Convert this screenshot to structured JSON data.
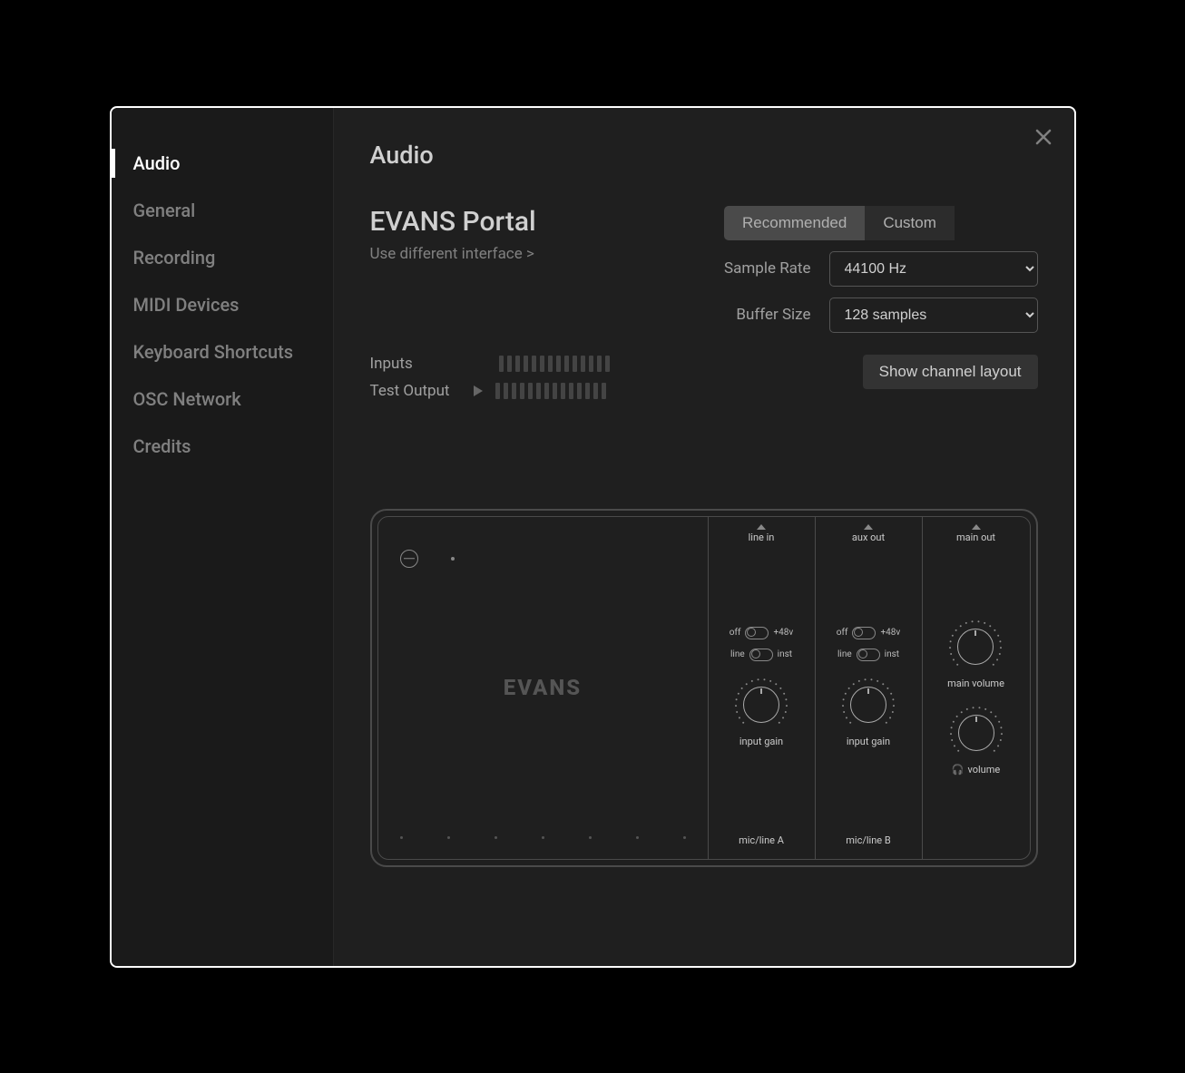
{
  "page_title": "Audio",
  "sidebar": {
    "items": [
      {
        "label": "Audio",
        "active": true
      },
      {
        "label": "General"
      },
      {
        "label": "Recording"
      },
      {
        "label": "MIDI Devices"
      },
      {
        "label": "Keyboard Shortcuts"
      },
      {
        "label": "OSC Network"
      },
      {
        "label": "Credits"
      }
    ]
  },
  "device": {
    "name": "EVANS Portal",
    "change_link": "Use different interface >"
  },
  "preset": {
    "recommended": "Recommended",
    "custom": "Custom"
  },
  "settings": {
    "sample_rate_label": "Sample Rate",
    "sample_rate_value": "44100 Hz",
    "buffer_label": "Buffer Size",
    "buffer_value": "128 samples"
  },
  "meters": {
    "inputs_label": "Inputs",
    "test_output_label": "Test Output",
    "channel_layout_btn": "Show channel layout"
  },
  "panel": {
    "brand": "EVANS",
    "sections": {
      "line_in": "line in",
      "aux_out": "aux out",
      "main_out": "main out"
    },
    "toggles": {
      "off": "off",
      "phantom": "+48v",
      "line": "line",
      "inst": "inst"
    },
    "knobs": {
      "input_gain": "input gain",
      "main_volume": "main volume",
      "volume": "volume"
    },
    "channels": {
      "a": "mic/line A",
      "b": "mic/line B"
    }
  }
}
